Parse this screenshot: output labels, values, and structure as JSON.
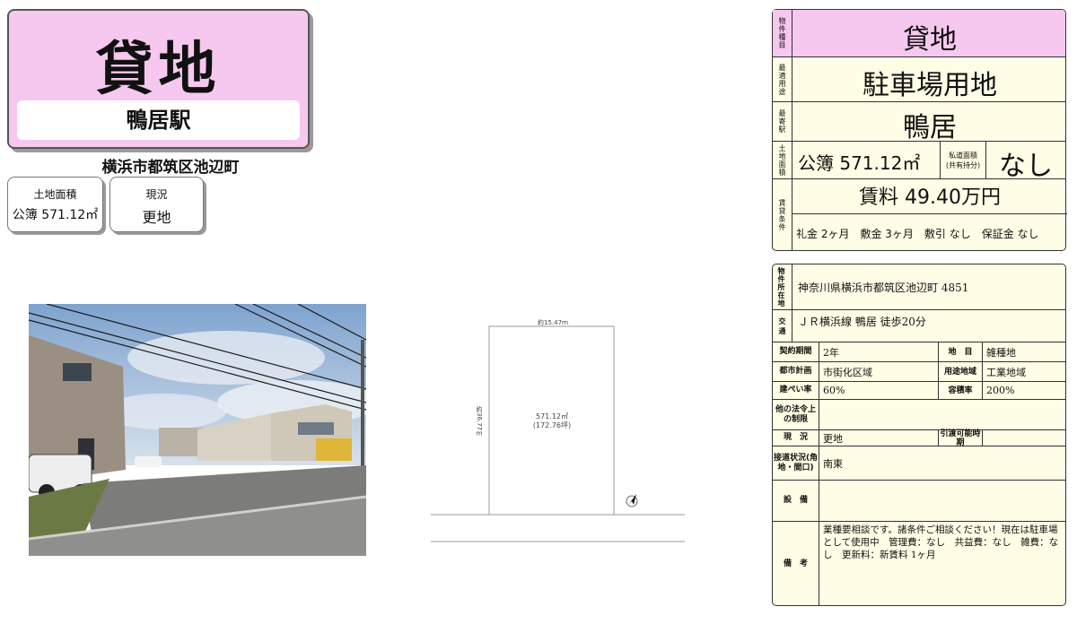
{
  "header": {
    "type": "貸地",
    "station": "鴨居駅",
    "address": "横浜市都筑区池辺町"
  },
  "summary": {
    "area_label": "土地面積",
    "area_value": "公簿 571.12㎡",
    "status_label": "現況",
    "status_value": "更地"
  },
  "plan": {
    "top_dim": "約15.47ｍ",
    "side_dim": "約36.77ｍ",
    "area_sqm": "571.12㎡",
    "area_tsubo": "(172.76坪)"
  },
  "spec": {
    "type_label": "物件種目",
    "type": "貸地",
    "use_label": "最適用途",
    "use": "駐車場用地",
    "station_label": "最寄駅",
    "station": "鴨居",
    "area_label": "土地面積",
    "area": "公簿 571.12㎡",
    "private_road_label": "私道面積",
    "private_road_sub": "(共有持分)",
    "private_road": "なし",
    "rent_label": "賃貸条件",
    "rent": "賃料 49.40万円",
    "terms": "礼金 2ヶ月　敷金 3ヶ月　敷引 なし　保証金 なし"
  },
  "details": {
    "location_label": "物件所在地",
    "location": "神奈川県横浜市都筑区池辺町 4851",
    "transport_label": "交　通",
    "transport": "ＪＲ横浜線 鴨居 徒歩20分",
    "contract_label": "契約期間",
    "contract": "2年",
    "land_cat_label": "地　目",
    "land_cat": "雑種地",
    "city_plan_label": "都市計画",
    "city_plan": "市街化区域",
    "zoning_label": "用途地域",
    "zoning": "工業地域",
    "bcr_label": "建ぺい率",
    "bcr": "60%",
    "far_label": "容積率",
    "far": "200%",
    "other_law_label": "他の法令上の制限",
    "other_law": "",
    "status_label": "現　況",
    "status": "更地",
    "handover_label": "引渡可能時期",
    "handover": "",
    "road_label": "接道状況(角地・間口)",
    "road": "南東",
    "facilities_label": "設　備",
    "facilities": "",
    "remarks_label": "備　考",
    "remarks": "業種要相談です。諸条件ご相談ください！現在は駐車場として使用中　管理費：なし　共益費：なし　雑費：なし　更新料：新賃料 1ヶ月"
  },
  "colors": {
    "pink": "#f7c8ef",
    "cream": "#fffde5"
  }
}
